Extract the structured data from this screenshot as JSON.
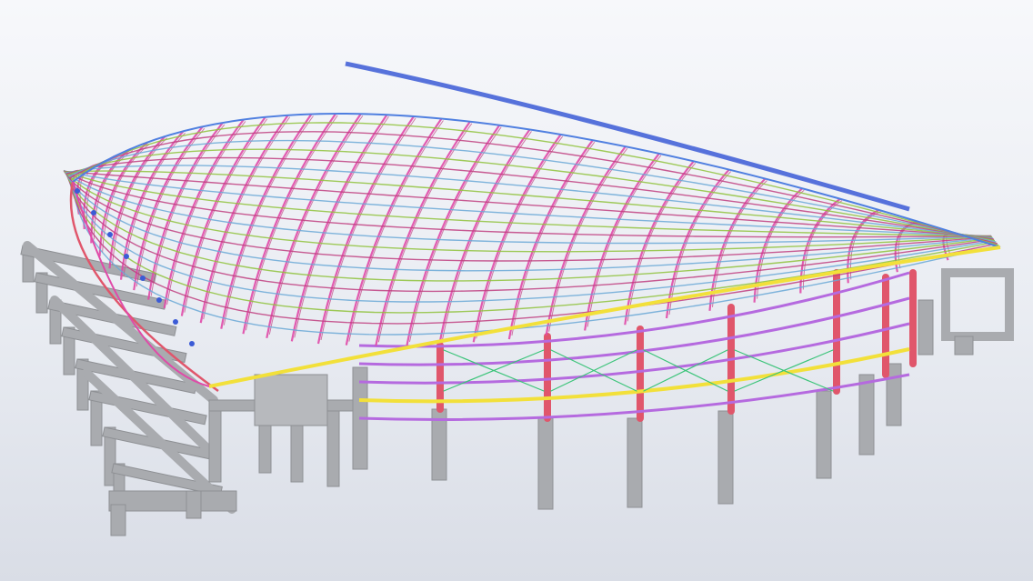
{
  "scene": {
    "description_colors": {
      "background_top": "#f7f8fb",
      "background_bottom": "#d9dde6",
      "concrete": "#a9abaf",
      "concrete_edge": "#8e9094",
      "column_steel": "#e0566b",
      "eave_beam": "#f2e03a",
      "girt": "#b56adf",
      "bracing": "#3cc47a",
      "roof_arch": "#e04aa8",
      "roof_purlin": "#8fc23c",
      "roof_secondary": "#c04080",
      "ridge": "#3b5bd6",
      "front_edge": "#4f7fe0"
    },
    "icons": {
      "model": "steel-structure-3d-model"
    }
  }
}
